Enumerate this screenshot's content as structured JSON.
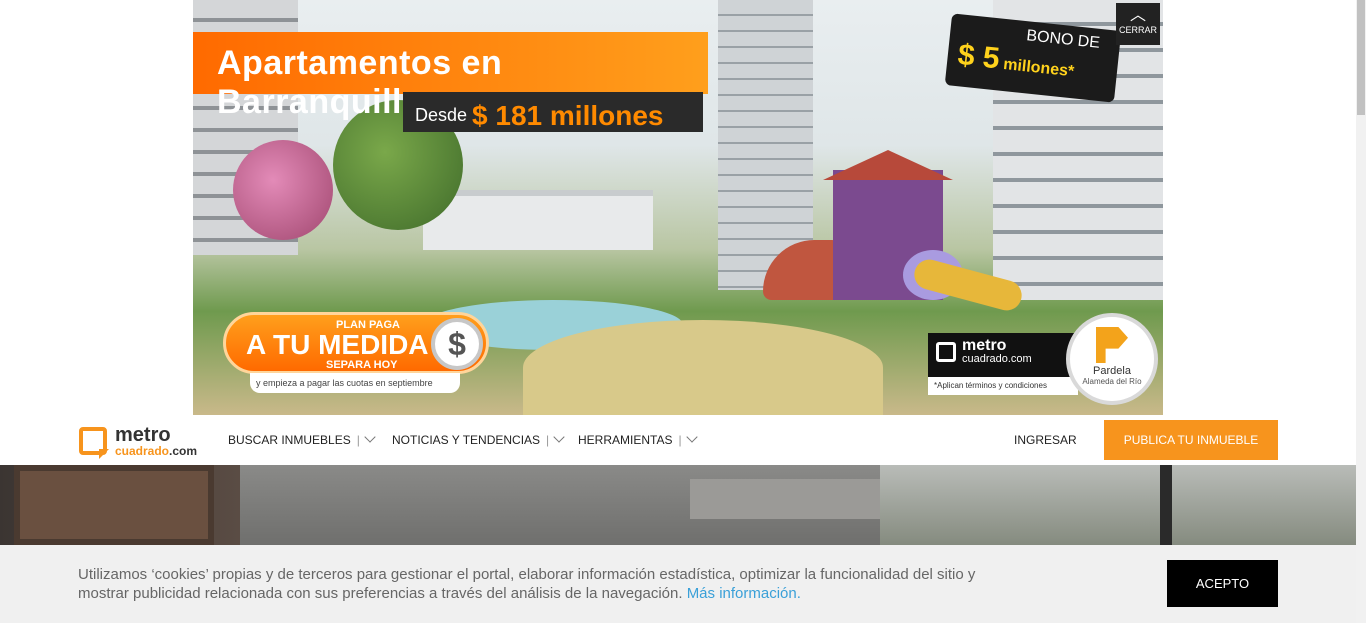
{
  "banner": {
    "title": "Apartamentos en Barranquilla",
    "subtitle_prefix": "Desde",
    "subtitle_amount": "$ 181 millones",
    "bono_label": "BONO DE",
    "bono_amount": "$ 5",
    "bono_unit": "millones*",
    "close_label": "CERRAR",
    "plan_line1": "PLAN PAGA",
    "plan_line2": "A TU MEDIDA",
    "plan_line3": "SEPARA HOY",
    "plan_dollar": "$",
    "plan_note": "y empieza a pagar las cuotas en septiembre",
    "logo_line1": "metro",
    "logo_line2": "cuadrado.com",
    "terms": "*Aplican términos y condiciones",
    "project_name": "Pardela",
    "project_sub": "Alameda del Río"
  },
  "nav": {
    "logo_line1": "metro",
    "logo_line2": "cuadrado",
    "logo_line2_suffix": ".com",
    "items": [
      {
        "label": "BUSCAR INMUEBLES"
      },
      {
        "label": "NOTICIAS Y TENDENCIAS"
      },
      {
        "label": "HERRAMIENTAS"
      }
    ],
    "separator": "|",
    "login_label": "INGRESAR",
    "publish_label": "PUBLICA TU INMUEBLE"
  },
  "cookie": {
    "text": "Utilizamos ‘cookies’ propias y de terceros para gestionar el portal, elaborar información estadística, optimizar la funcionalidad del sitio y mostrar publicidad relacionada con sus preferencias a través del análisis de la navegación.",
    "link": "Más información.",
    "accept_label": "ACEPTO"
  },
  "colors": {
    "brand_orange": "#f7941d",
    "link_blue": "#3aa0d8"
  }
}
